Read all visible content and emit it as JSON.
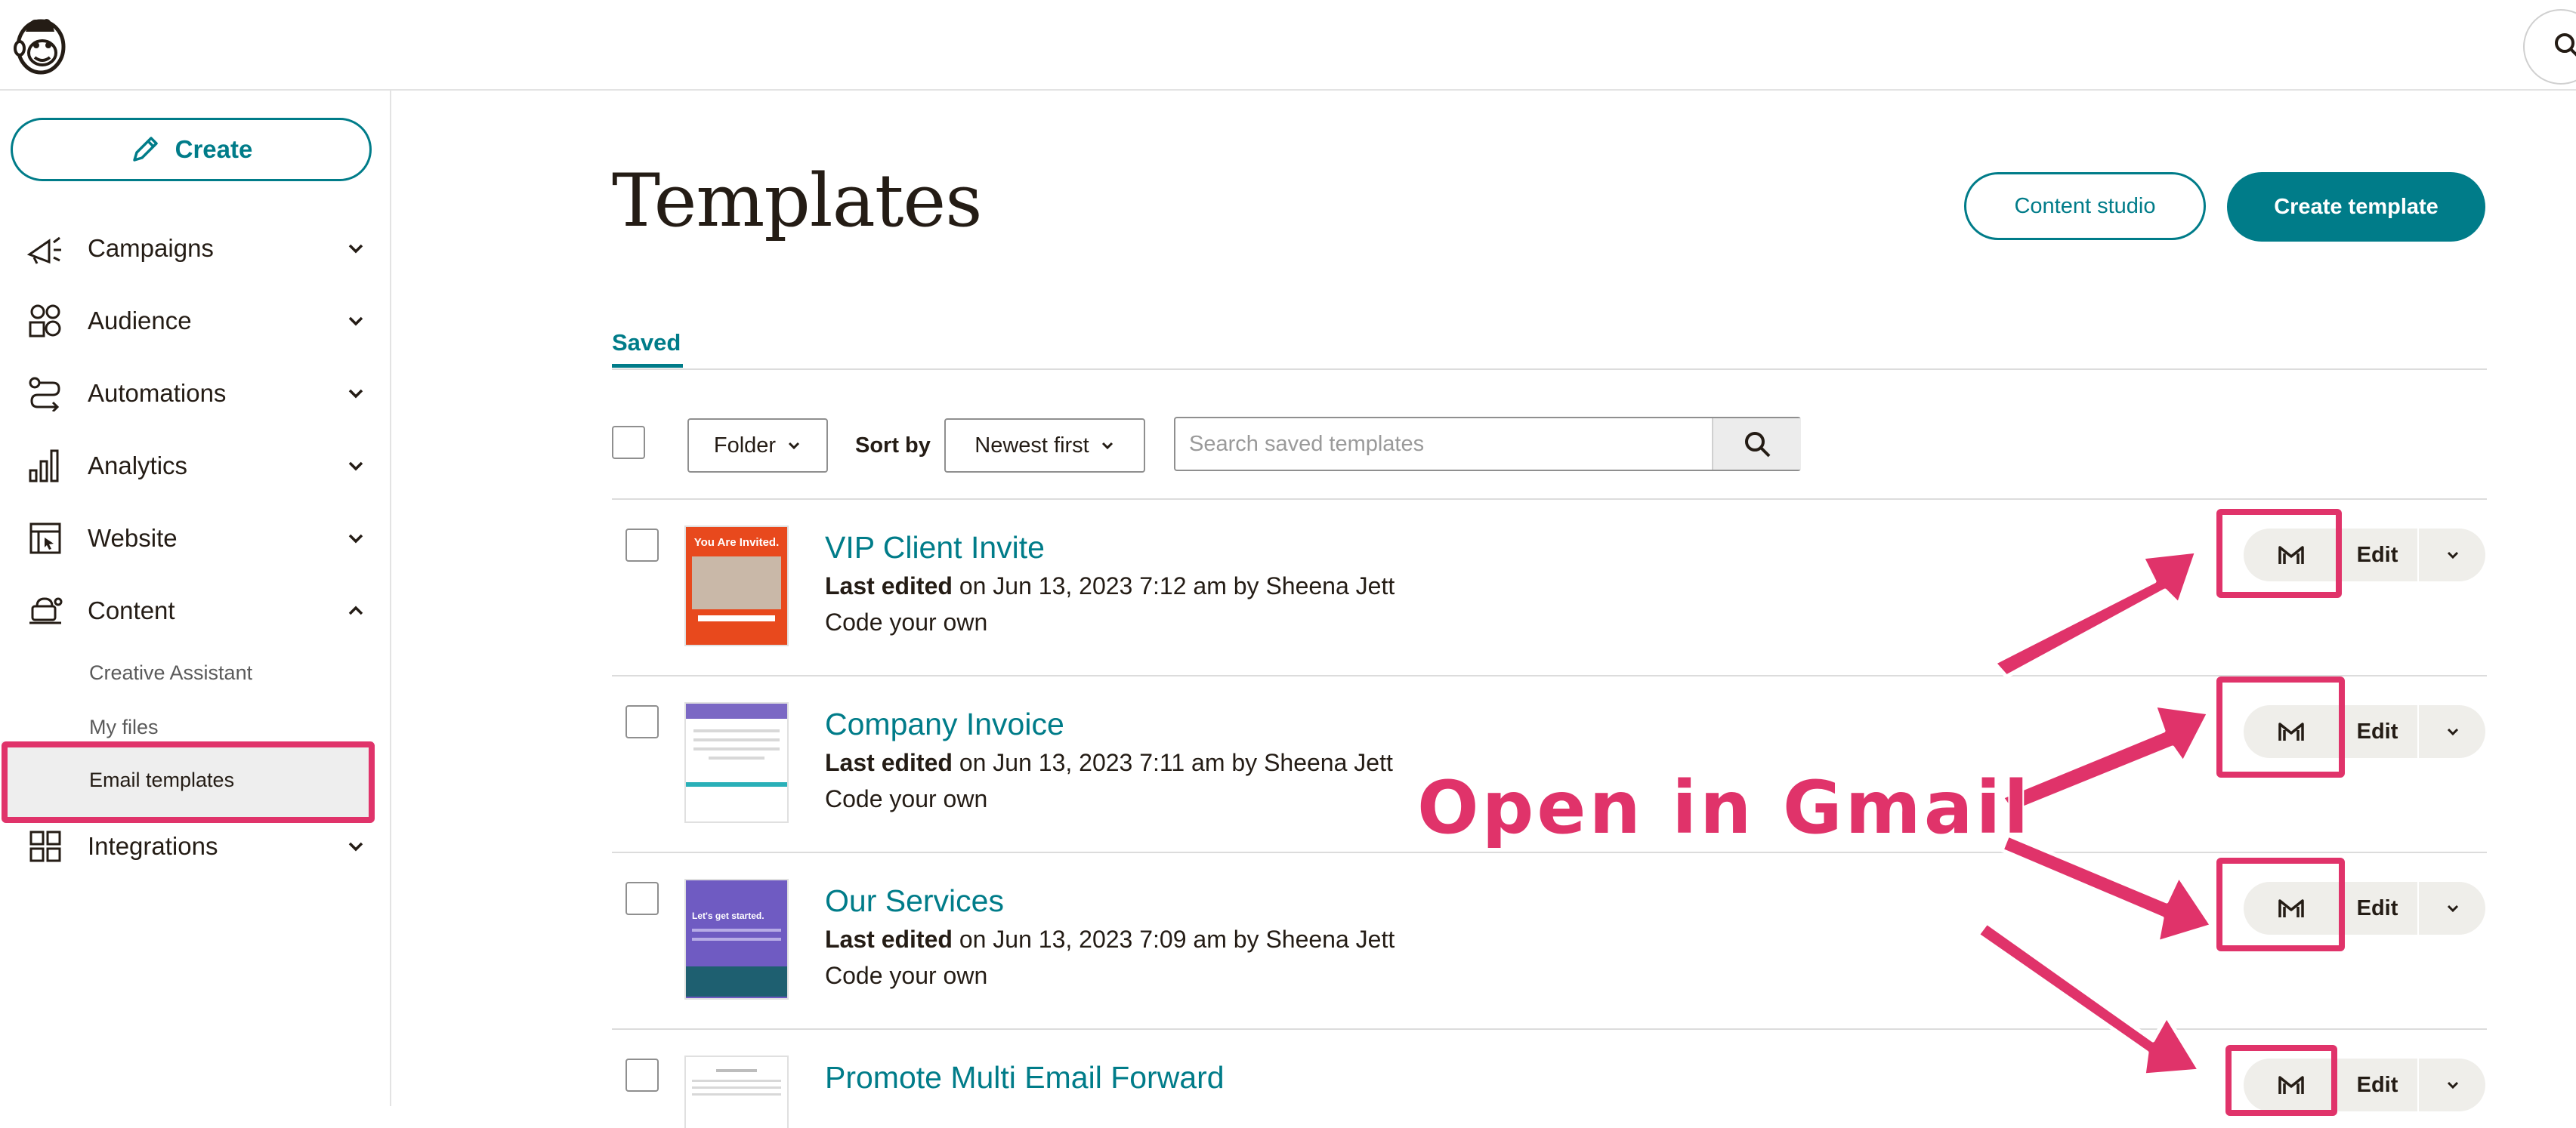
{
  "app": {
    "logo_icon": "freddie-logo-icon",
    "top_search_icon": "search-icon"
  },
  "sidebar": {
    "create_label": "Create",
    "items": [
      {
        "label": "Campaigns",
        "icon": "megaphone-icon"
      },
      {
        "label": "Audience",
        "icon": "audience-icon"
      },
      {
        "label": "Automations",
        "icon": "automations-icon"
      },
      {
        "label": "Analytics",
        "icon": "bar-chart-icon"
      },
      {
        "label": "Website",
        "icon": "website-icon"
      },
      {
        "label": "Content",
        "icon": "content-icon"
      },
      {
        "label": "Integrations",
        "icon": "grid-icon"
      }
    ],
    "content_sub": [
      "Creative Assistant",
      "My files",
      "Email templates"
    ],
    "active_sub": "Email templates"
  },
  "page": {
    "title": "Templates",
    "content_studio_label": "Content studio",
    "create_template_label": "Create template",
    "tabs": [
      "Saved"
    ]
  },
  "toolbar": {
    "folder_label": "Folder",
    "sort_by_label": "Sort by",
    "sort_value": "Newest first",
    "search_placeholder": "Search saved templates"
  },
  "templates": [
    {
      "name": "VIP Client Invite",
      "last_edited_label": "Last edited",
      "meta": " on Jun 13, 2023 7:12 am by Sheena Jett",
      "type": "Code your own",
      "thumb_text": "You Are Invited."
    },
    {
      "name": "Company Invoice",
      "last_edited_label": "Last edited",
      "meta": " on Jun 13, 2023 7:11 am by Sheena Jett",
      "type": "Code your own"
    },
    {
      "name": "Our Services",
      "last_edited_label": "Last edited",
      "meta": " on Jun 13, 2023 7:09 am by Sheena Jett",
      "type": "Code your own",
      "thumb_text": "Let's get started."
    },
    {
      "name": "Promote Multi Email Forward"
    }
  ],
  "row_actions": {
    "gmail_icon": "gmail-icon",
    "edit_label": "Edit",
    "more_icon": "chevron-down-icon"
  },
  "annotation": {
    "text": "Open in Gmail",
    "color": "#e0336a"
  },
  "colors": {
    "accent": "#007c89",
    "highlight": "#e0336a"
  }
}
